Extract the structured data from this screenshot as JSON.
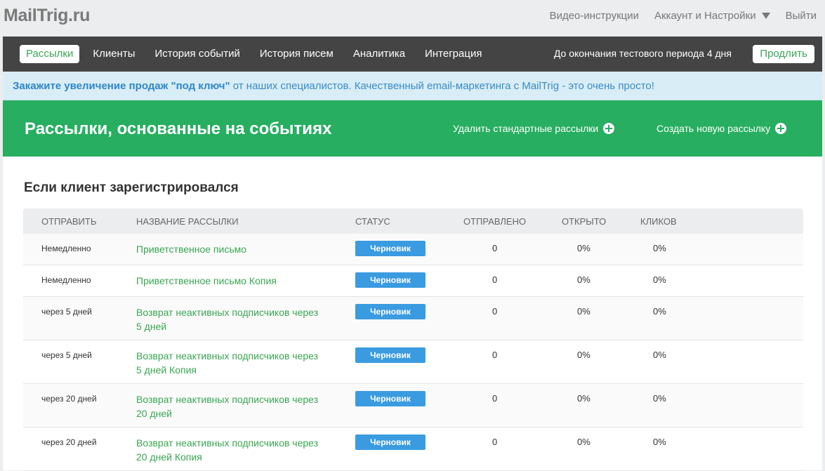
{
  "brand": {
    "logo": "MailTrig.ru"
  },
  "top_links": {
    "video": "Видео-инструкции",
    "account": "Аккаунт и Настройки",
    "logout": "Выйти"
  },
  "nav": {
    "items": [
      "Рассылки",
      "Клиенты",
      "История событий",
      "История писем",
      "Аналитика",
      "Интеграция"
    ],
    "trial": "До окончания тестового периода 4 дня",
    "extend": "Продлить"
  },
  "promo": {
    "bold": "Закажите увеличение продаж \"под ключ\"",
    "rest": " от наших специалистов. Качественный email-маркетинга с MailTrig - это очень просто!"
  },
  "hero": {
    "title": "Рассылки, основанные на событиях",
    "delete_label": "Удалить стандартные рассылки",
    "create_label": "Создать новую рассылку"
  },
  "section": {
    "title": "Если клиент зарегистрировался"
  },
  "table": {
    "headers": [
      "ОТПРАВИТЬ",
      "НАЗВАНИЕ РАССЫЛКИ",
      "СТАТУС",
      "ОТПРАВЛЕНО",
      "ОТКРЫТО",
      "КЛИКОВ"
    ],
    "rows": [
      {
        "send": "Немедленно",
        "name": "Приветственное письмо",
        "status": "Черновик",
        "sent": "0",
        "opened": "0%",
        "clicks": "0%"
      },
      {
        "send": "Немедленно",
        "name": "Приветственное письмо Копия",
        "status": "Черновик",
        "sent": "0",
        "opened": "0%",
        "clicks": "0%"
      },
      {
        "send": "через 5 дней",
        "name": "Возврат неактивных подписчиков через 5 дней",
        "status": "Черновик",
        "sent": "0",
        "opened": "0%",
        "clicks": "0%"
      },
      {
        "send": "через 5 дней",
        "name": "Возврат неактивных подписчиков через 5 дней Копия",
        "status": "Черновик",
        "sent": "0",
        "opened": "0%",
        "clicks": "0%"
      },
      {
        "send": "через 20 дней",
        "name": "Возврат неактивных подписчиков через 20 дней",
        "status": "Черновик",
        "sent": "0",
        "opened": "0%",
        "clicks": "0%"
      },
      {
        "send": "через 20 дней",
        "name": "Возврат неактивных подписчиков через 20 дней Копия",
        "status": "Черновик",
        "sent": "0",
        "opened": "0%",
        "clicks": "0%"
      }
    ]
  }
}
